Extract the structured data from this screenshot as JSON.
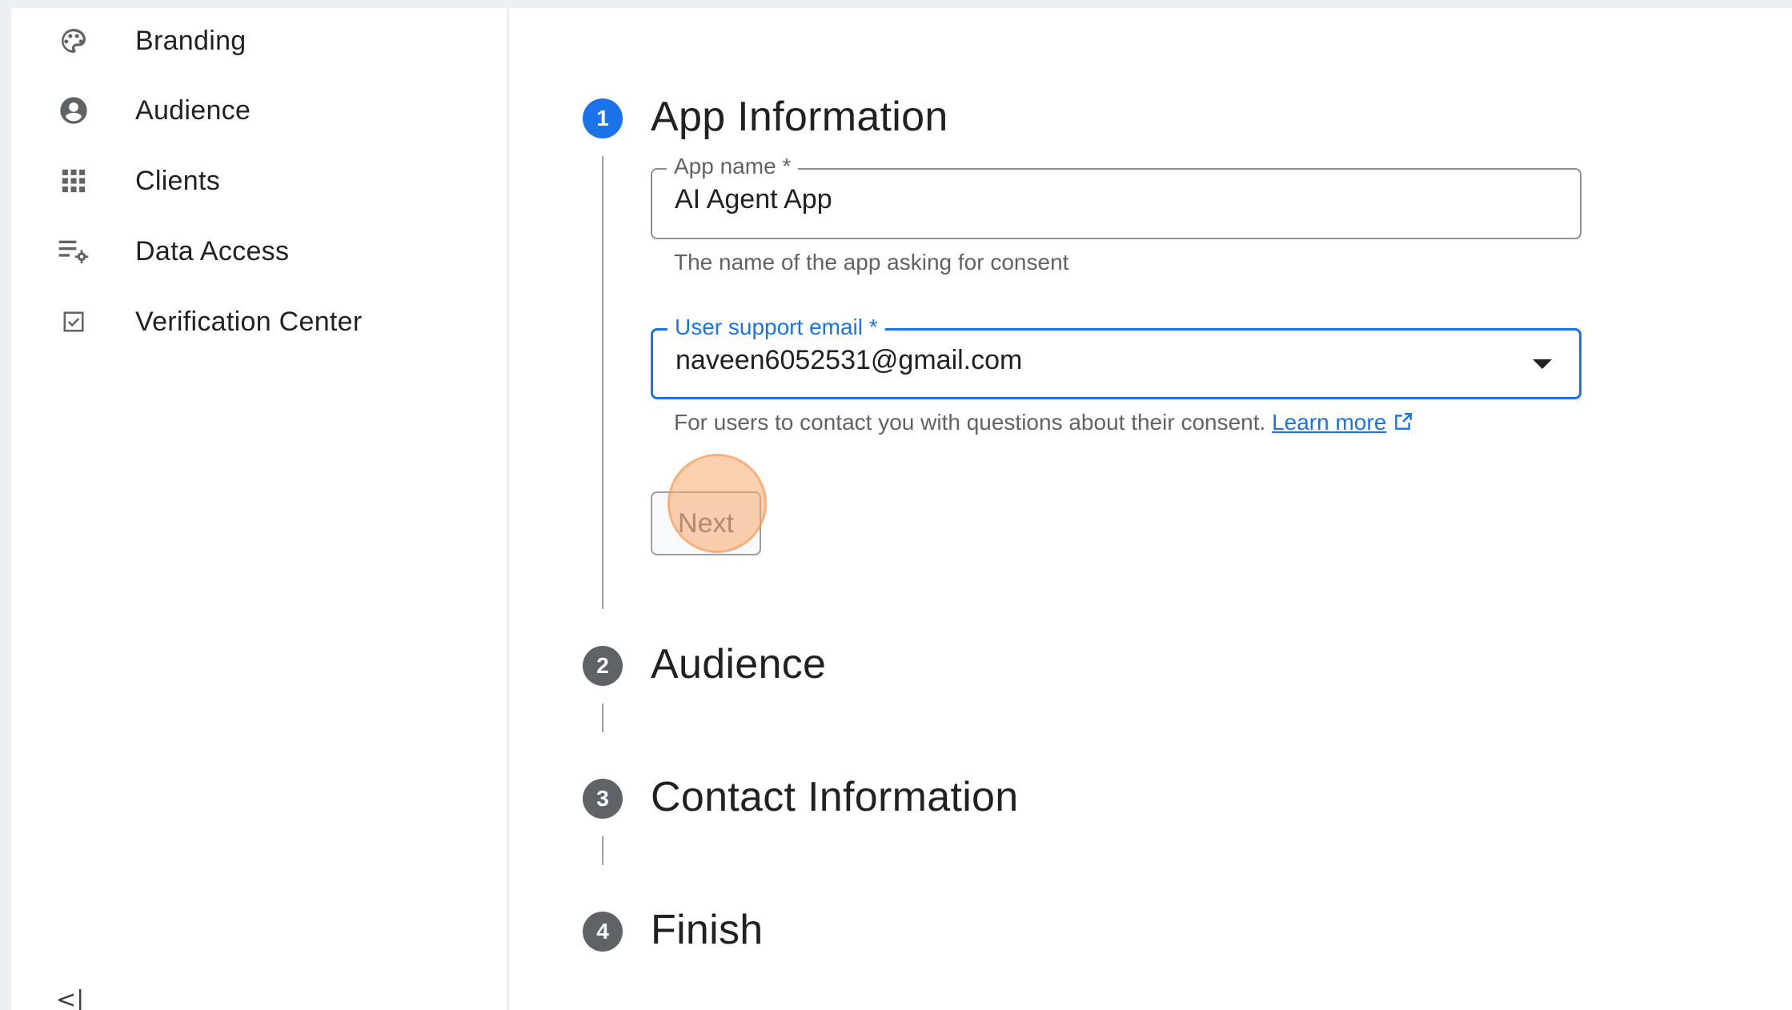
{
  "sidebar": {
    "items": [
      {
        "label": "Branding",
        "icon": "palette-icon"
      },
      {
        "label": "Audience",
        "icon": "account-circle-icon"
      },
      {
        "label": "Clients",
        "icon": "apps-grid-icon"
      },
      {
        "label": "Data Access",
        "icon": "list-settings-icon"
      },
      {
        "label": "Verification Center",
        "icon": "checkbox-icon"
      }
    ],
    "collapse_label": "<|"
  },
  "stepper": {
    "steps": [
      {
        "number": "1",
        "title": "App Information"
      },
      {
        "number": "2",
        "title": "Audience"
      },
      {
        "number": "3",
        "title": "Contact Information"
      },
      {
        "number": "4",
        "title": "Finish"
      }
    ]
  },
  "form": {
    "app_name": {
      "label": "App name *",
      "value": "AI Agent App",
      "helper": "The name of the app asking for consent"
    },
    "support_email": {
      "label": "User support email *",
      "value": "naveen6052531@gmail.com",
      "helper": "For users to contact you with questions about their consent.",
      "learn_more": "Learn more"
    },
    "next_label": "Next"
  },
  "colors": {
    "accent": "#1a73e8",
    "step_inactive": "#5f6368",
    "click_highlight": "#f6aa6e"
  }
}
